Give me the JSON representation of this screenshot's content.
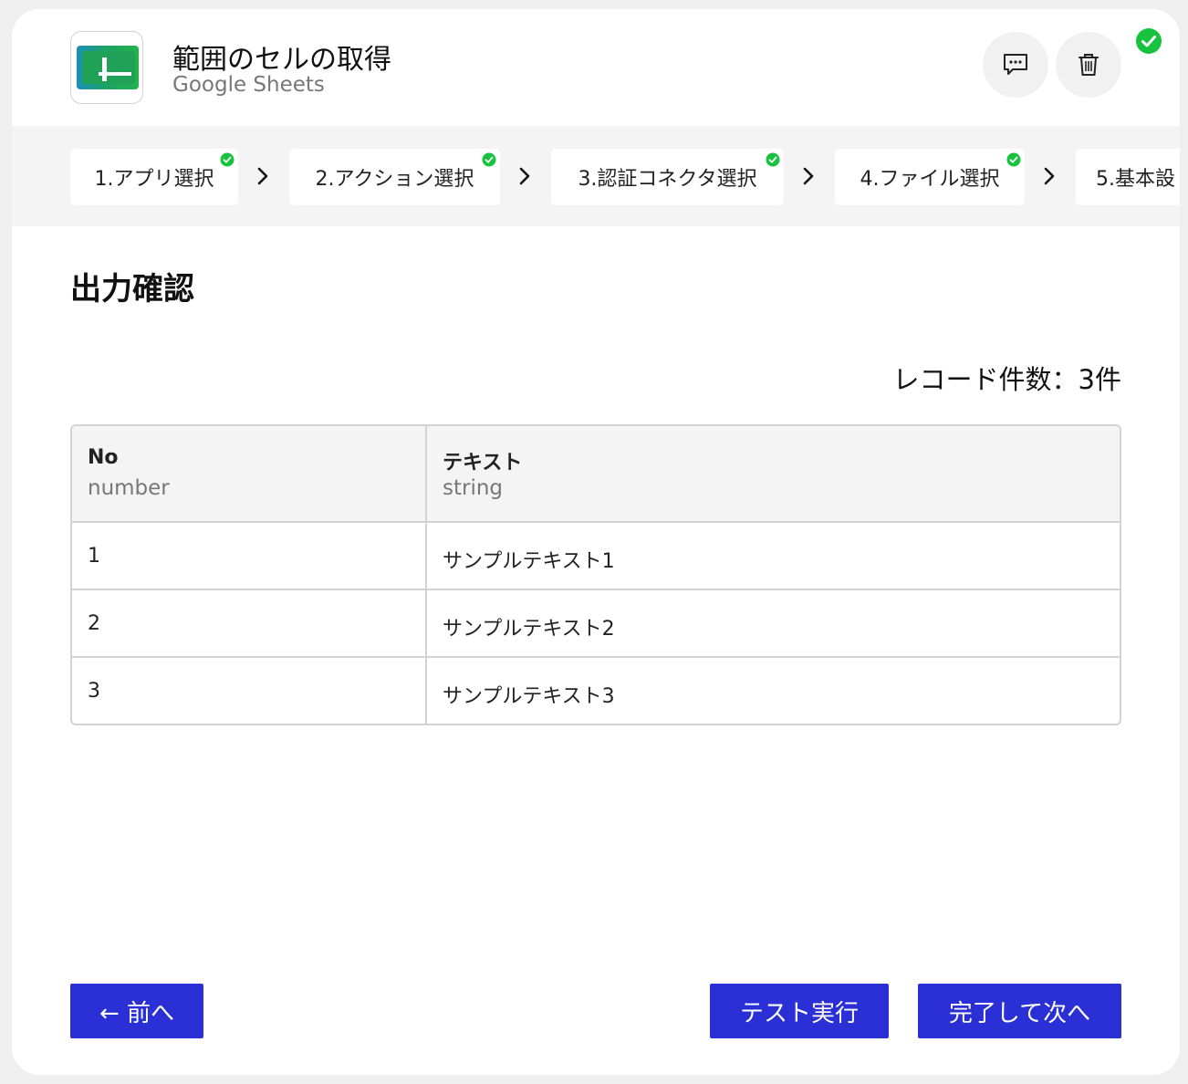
{
  "header": {
    "title": "範囲のセルの取得",
    "subtitle": "Google Sheets",
    "logo_icon": "google-sheets-logo",
    "colors": {
      "logo_green": "#1ea362",
      "done_green": "#17c23d"
    }
  },
  "steps": [
    {
      "label": "1.アプリ選択",
      "done": true
    },
    {
      "label": "2.アクション選択",
      "done": true
    },
    {
      "label": "3.認証コネクタ選択",
      "done": true
    },
    {
      "label": "4.ファイル選択",
      "done": true
    },
    {
      "label": "5.基本設",
      "done": false
    }
  ],
  "main": {
    "section_title": "出力確認",
    "record_count": "レコード件数：3件",
    "table": {
      "columns": [
        {
          "name": "No",
          "type": "number"
        },
        {
          "name": "テキスト",
          "type": "string"
        }
      ],
      "rows": [
        [
          "1",
          "サンプルテキスト1"
        ],
        [
          "2",
          "サンプルテキスト2"
        ],
        [
          "3",
          "サンプルテキスト3"
        ]
      ]
    }
  },
  "footer": {
    "prev_label": "← 前へ",
    "test_label": "テスト実行",
    "next_label": "完了して次へ",
    "button_color": "#2b2fd6"
  }
}
